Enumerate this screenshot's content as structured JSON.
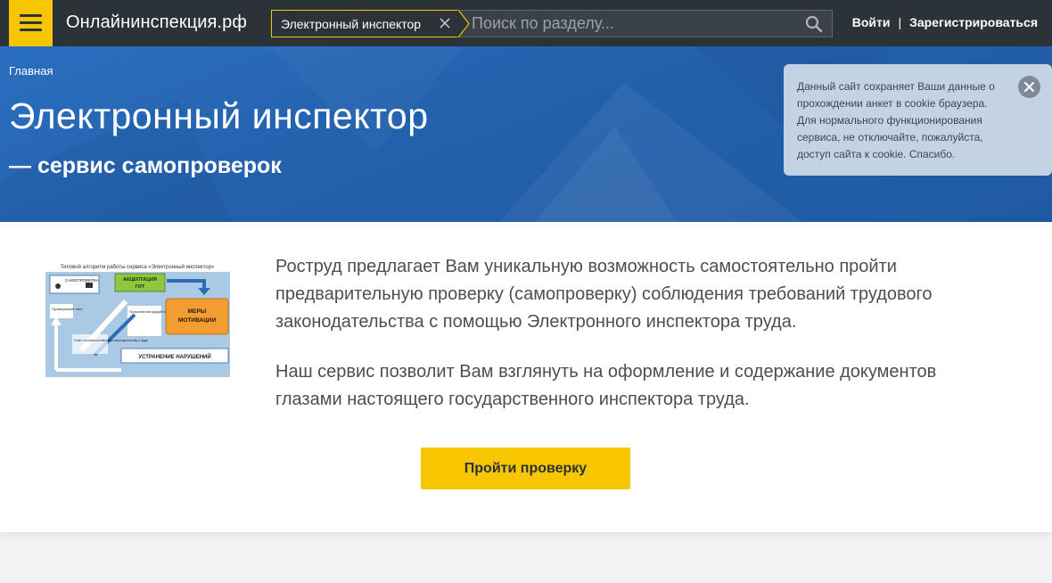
{
  "header": {
    "site_title": "Онлайнинспекция.рф",
    "search_scope": "Электронный инспектор",
    "search_placeholder": "Поиск по разделу...",
    "login_label": "Войти",
    "separator": "|",
    "register_label": "Зарегистрироваться"
  },
  "hero": {
    "breadcrumb": "Главная",
    "title": "Электронный инспектор",
    "subtitle": "— сервис самопроверок"
  },
  "cookie_notice": {
    "text": "Данный сайт сохраняет Ваши данные о прохождении анкет в cookie браузера. Для нормального функционирования сервиса, не отключайте, пожалуйста, доступ сайта к cookie. Спасибо."
  },
  "main": {
    "diagram": {
      "title": "Типовой алгоритм работы сервиса «Электронный инспектор»",
      "box_self_check": "САМОПРОВЕРКА",
      "box_accept_line1": "АКЦЕПТАЦИЯ",
      "box_accept_line2": "ГИТ",
      "box_measures_line1": "МЕРЫ",
      "box_measures_line2": "МОТИВАЦИИ",
      "box_fix": "УСТРАНЕНИЕ НАРУШЕНИЙ",
      "label_checklist": "Проверочный лист",
      "label_instructions": "Получение инструкций по устранению нарушений",
      "label_notify": "Отчёт о полном соответствии законодательству о труде"
    },
    "paragraph_1": "Роструд предлагает Вам уникальную возможность самостоятельно пройти предварительную проверку (самопроверку) соблюдения требований трудового законодательства с помощью Электронного инспектора труда.",
    "paragraph_2": "Наш сервис позволит Вам взглянуть на оформление и содержание документов глазами настоящего государственного инспектора труда.",
    "cta_label": "Пройти проверку"
  },
  "colors": {
    "accent": "#f7c600",
    "topbar": "#2b3238",
    "hero": "#2461ad",
    "cookie_bg": "#c4d3e4"
  },
  "icons": {
    "menu": "hamburger-icon",
    "clear": "close-icon",
    "search": "search-icon",
    "cookie_close": "close-icon"
  }
}
